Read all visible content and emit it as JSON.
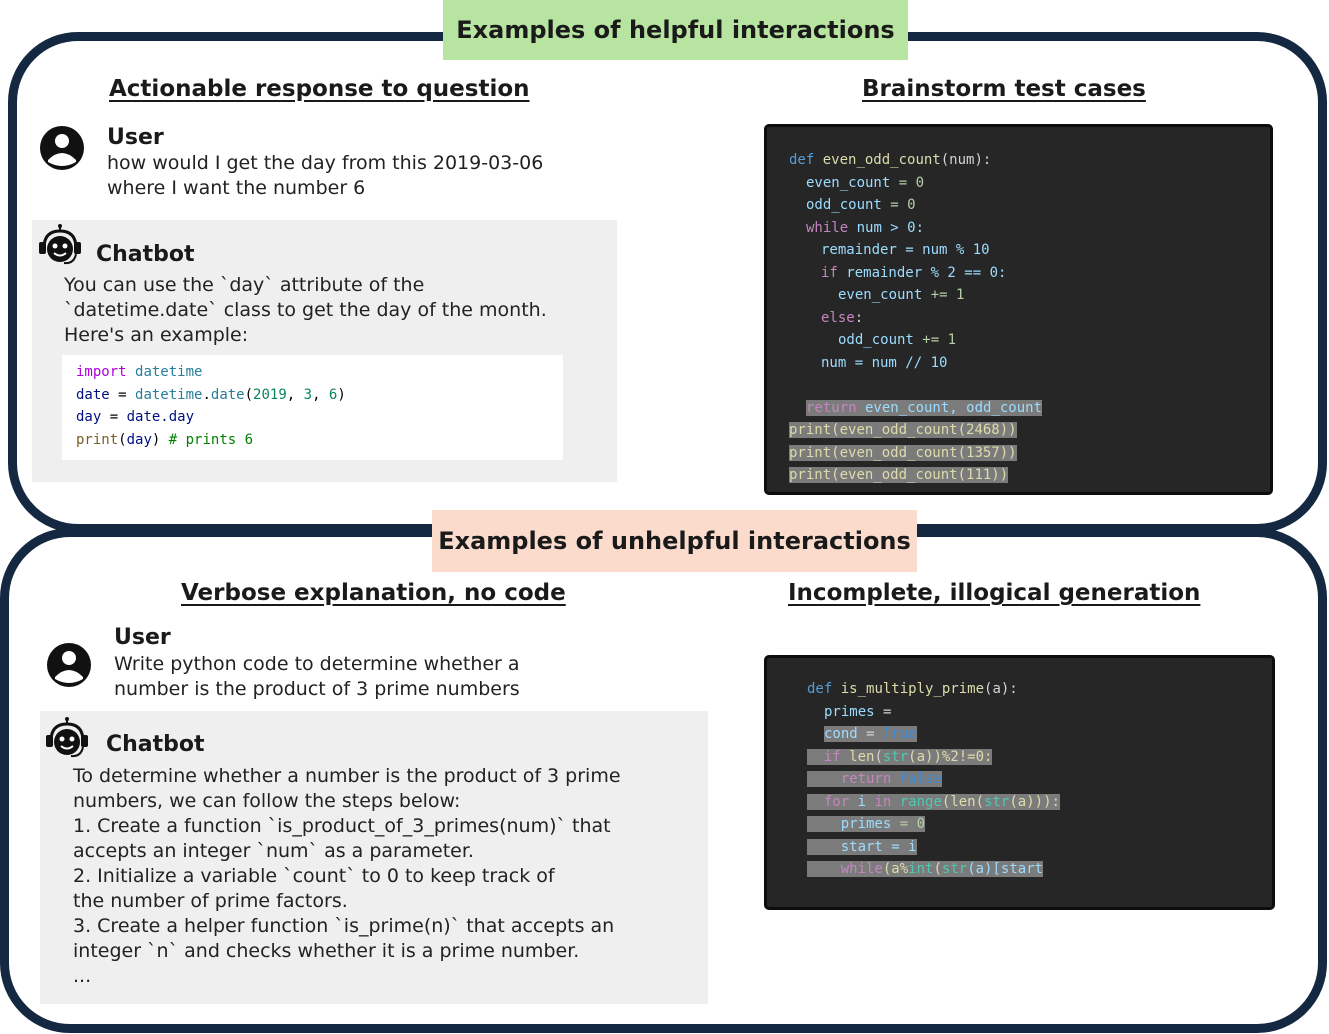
{
  "banners": {
    "helpful": "Examples of helpful interactions",
    "unhelpful": "Examples of unhelpful interactions"
  },
  "top_left": {
    "heading": "Actionable response to question",
    "user_label": "User",
    "user_message": "how would I get the day from this 2019-03-06\nwhere I want the number 6",
    "bot_label": "Chatbot",
    "bot_message": "You can use the `day` attribute of the\n`datetime.date` class to get the day of the month.\nHere's an example:",
    "code": {
      "l1_kw": "import",
      "l1_mod": "datetime",
      "l2_var": "date",
      "l2_eq": " = ",
      "l2_mod": "datetime",
      "l2_dot": ".",
      "l2_fn": "date",
      "l2_open": "(",
      "l2_n1": "2019",
      "l2_c1": ", ",
      "l2_n2": "3",
      "l2_c2": ", ",
      "l2_n3": "6",
      "l2_close": ")",
      "l3_var": "day",
      "l3_eq": " = ",
      "l3_val": "date.day",
      "l4_fn": "print",
      "l4_open": "(",
      "l4_arg": "day",
      "l4_close": ") ",
      "l4_cm": "# prints 6"
    }
  },
  "top_right": {
    "heading": "Brainstorm test cases",
    "code": {
      "def": "def",
      "fname": " even_odd_count",
      "params": "(num):",
      "even_init_var": "even_count",
      "even_init_rest": " = 0",
      "odd_init_var": "odd_count",
      "odd_init_rest": " = 0",
      "while_kw": "while",
      "while_rest": " num > 0:",
      "rem_var": "remainder",
      "rem_rest": " = num % 10",
      "if_kw": "if",
      "if_rest": " remainder % 2 == 0:",
      "even_inc_var": "even_count",
      "even_inc_rest": " += 1",
      "else_kw": "else",
      "else_rest": ":",
      "odd_inc_var": "odd_count",
      "odd_inc_rest": " += 1",
      "num_div": "num = num // 10",
      "return_kw": "return",
      "return_rest": " even_count, odd_count",
      "print1_fn": "print",
      "print1_rest": "(even_odd_count(2468))",
      "print2_fn": "print",
      "print2_rest": "(even_odd_count(1357))",
      "print3_fn": "print",
      "print3_rest": "(even_odd_count(111))"
    }
  },
  "bottom_left": {
    "heading": "Verbose explanation, no code",
    "user_label": "User",
    "user_message": "Write python code to determine whether a\nnumber is the product of 3 prime numbers",
    "bot_label": "Chatbot",
    "bot_message": "To determine whether a number is the product of 3 prime\nnumbers, we can follow the steps below:\n1. Create a function `is_product_of_3_primes(num)` that\naccepts an integer `num` as a parameter.\n2. Initialize a variable `count` to 0 to keep track of\nthe number of prime factors.\n3. Create a helper function `is_prime(n)` that accepts an\ninteger `n` and checks whether it is a prime number.\n..."
  },
  "bottom_right": {
    "heading": "Incomplete, illogical generation",
    "code": {
      "def": "def",
      "fname": " is_multiply_prime",
      "params": "(a):",
      "primes_var": "primes",
      "primes_rest": " =",
      "cond_var": "cond",
      "cond_eq": " = ",
      "cond_true": "True",
      "if_kw": "if",
      "if_len": " len",
      "if_open": "(",
      "if_str": "str",
      "if_rest": "(a))%2!=0:",
      "return_kw": "return",
      "return_false": " False",
      "for_kw": "for",
      "for_i": " i ",
      "for_in": "in",
      "for_range": " range",
      "for_open": "(",
      "for_len": "len",
      "for_open2": "(",
      "for_str": "str",
      "for_rest": "(a))):",
      "primes2_var": "primes",
      "primes2_rest": " = 0",
      "start_var": "start",
      "start_rest": " = i",
      "while_kw": "while",
      "while_open": "(a%",
      "while_int": "int",
      "while_open2": "(",
      "while_str": "str",
      "while_rest": "(a)[start"
    }
  },
  "icons": {
    "user": "user-avatar-icon",
    "bot": "chatbot-headset-icon"
  },
  "colors": {
    "frame": "#142842",
    "helpful_banner": "#b7e4a0",
    "unhelpful_banner": "#fbdccc",
    "code_dark_bg": "#262626",
    "highlight": "#7b7b7b"
  }
}
